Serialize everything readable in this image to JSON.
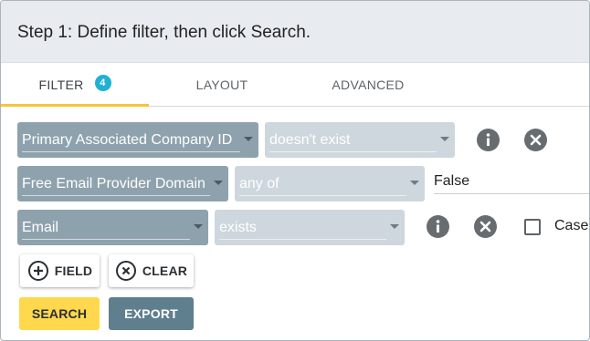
{
  "header": {
    "title": "Step 1: Define filter, then click Search."
  },
  "tabs": [
    {
      "label": "FILTER",
      "badge": "4",
      "active": true
    },
    {
      "label": "LAYOUT",
      "active": false
    },
    {
      "label": "ADVANCED",
      "active": false
    }
  ],
  "filters": [
    {
      "field": "Primary Associated Company ID",
      "operator": "doesn't exist",
      "value": ""
    },
    {
      "field": "Free Email Provider Domain",
      "operator": "any of",
      "value": "False"
    },
    {
      "field": "Email",
      "operator": "exists",
      "value": "",
      "case_label": "Case"
    }
  ],
  "buttons": {
    "add_field": "FIELD",
    "clear": "CLEAR",
    "search": "SEARCH",
    "export": "EXPORT"
  },
  "icons": {
    "info": "info-icon",
    "remove": "close-circle-icon",
    "add": "plus-circle-icon",
    "clear": "x-circle-icon"
  },
  "colors": {
    "accent": "#f5c63a",
    "badge": "#1fb1d3",
    "field_select": "#8ea2ae",
    "operator_select": "#cdd7dd",
    "search_button": "#ffd84d",
    "export_button": "#5f7f8f"
  }
}
